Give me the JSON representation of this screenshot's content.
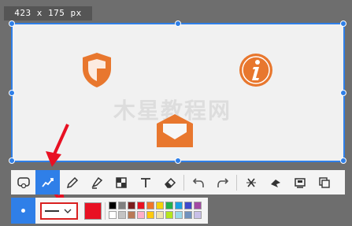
{
  "size_label": "423 x 175  px",
  "watermark": "木星教程网",
  "selection_color": "#2f7fe8",
  "icons": {
    "shield": "shield-icon",
    "info": "info-icon",
    "mail": "mail-icon"
  },
  "icon_color": "#e8772e",
  "toolbar": {
    "tools": [
      {
        "name": "rectangle-tool",
        "icon": "rect-outline-icon",
        "active": false
      },
      {
        "name": "pen-tool",
        "icon": "freeline-icon",
        "active": true
      },
      {
        "name": "pencil-tool",
        "icon": "pencil-icon",
        "active": false
      },
      {
        "name": "highlighter-tool",
        "icon": "highlighter-icon",
        "active": false
      },
      {
        "name": "mosaic-tool",
        "icon": "mosaic-icon",
        "active": false
      },
      {
        "name": "text-tool",
        "icon": "text-icon",
        "active": false
      },
      {
        "name": "eraser-tool",
        "icon": "eraser-icon",
        "active": false
      },
      {
        "name": "undo-button",
        "icon": "undo-icon",
        "active": false
      },
      {
        "name": "redo-button",
        "icon": "redo-icon",
        "active": false
      },
      {
        "name": "cancel-button",
        "icon": "close-icon",
        "active": false
      },
      {
        "name": "pin-button",
        "icon": "pin-icon",
        "active": false
      },
      {
        "name": "save-button",
        "icon": "save-icon",
        "active": false
      },
      {
        "name": "copy-button",
        "icon": "copy-icon",
        "active": false
      }
    ]
  },
  "options": {
    "selected_color": "#e81123",
    "palette": [
      "#000000",
      "#808080",
      "#7a1e1e",
      "#e81123",
      "#f0762a",
      "#f5d20a",
      "#22b14c",
      "#1b9fe3",
      "#3f48cc",
      "#a349a4",
      "#ffffff",
      "#c3c3c3",
      "#b97a57",
      "#ffaec9",
      "#ffc90e",
      "#efe4b0",
      "#b5e61d",
      "#99d9ea",
      "#7092be",
      "#c8bfe7"
    ]
  }
}
